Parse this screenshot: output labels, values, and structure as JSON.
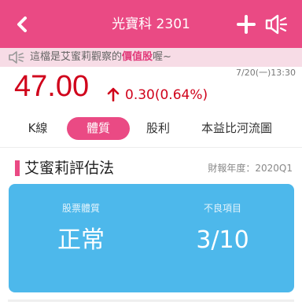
{
  "header": {
    "title": "光寶科 2301",
    "bg_color": "#ea4a84"
  },
  "notice": {
    "prefix": "這檔是艾蜜莉觀察的",
    "highlight": "價值股",
    "suffix": "喔~"
  },
  "quote": {
    "price": "47.00",
    "change": "0.30(0.64%)",
    "direction": "up",
    "timestamp": "7/20(一)13:30",
    "up_color": "#d0021b"
  },
  "tabs": [
    {
      "label": "K線",
      "active": false
    },
    {
      "label": "體質",
      "active": true
    },
    {
      "label": "股利",
      "active": false
    },
    {
      "label": "本益比河流圖",
      "active": false
    }
  ],
  "section": {
    "title": "艾蜜莉評估法",
    "report_year": "財報年度：2020Q1"
  },
  "card": {
    "bg_color": "#4db8eb",
    "left_label": "股票體質",
    "left_value": "正常",
    "right_label": "不良項目",
    "right_value": "3/10"
  },
  "icons": [
    "back-icon",
    "plus-icon",
    "speaker-icon",
    "notice-speaker-icon",
    "up-arrow-icon"
  ]
}
